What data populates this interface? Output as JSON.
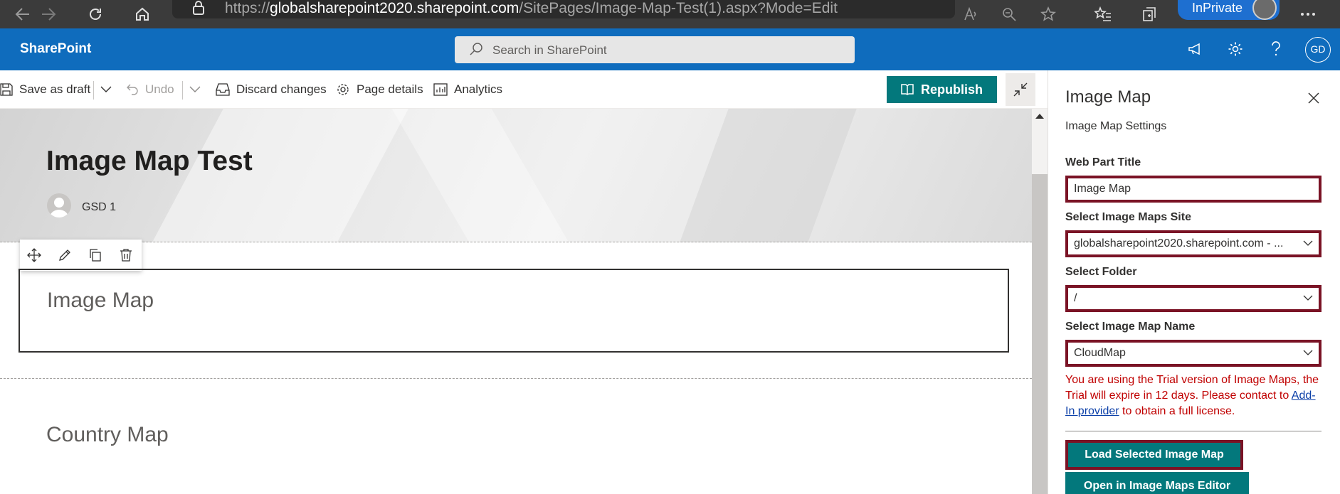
{
  "browser": {
    "url_prefix": "https://",
    "url_domain": "globalsharepoint2020.sharepoint.com",
    "url_path": "/SitePages/Image-Map-Test(1).aspx?Mode=Edit",
    "inprivate_label": "InPrivate",
    "icons": [
      "back-icon",
      "forward-icon",
      "refresh-icon",
      "home-icon",
      "lock-icon",
      "read-aloud-icon",
      "zoom-icon",
      "add-favorite-icon",
      "favorites-icon",
      "collections-icon",
      "more-icon"
    ]
  },
  "suite": {
    "brand": "SharePoint",
    "search_placeholder": "Search in SharePoint",
    "user_initials": "GD",
    "color": "#0f6cbd"
  },
  "commands": {
    "save_draft": "Save as draft",
    "undo": "Undo",
    "discard": "Discard changes",
    "page_details": "Page details",
    "analytics": "Analytics",
    "republish": "Republish"
  },
  "page": {
    "title": "Image Map Test",
    "author": "GSD 1",
    "webpart_title": "Image Map",
    "section_title": "Country Map"
  },
  "pane": {
    "title": "Image Map",
    "subtitle": "Image Map Settings",
    "webpart_title_label": "Web Part Title",
    "webpart_title_value": "Image Map",
    "site_label": "Select Image Maps Site",
    "site_value": "globalsharepoint2020.sharepoint.com - ...",
    "folder_label": "Select Folder",
    "folder_value": "/",
    "name_label": "Select Image Map Name",
    "name_value": "CloudMap",
    "trial_text_1": "You are using the Trial version of Image Maps, the Trial will expire in 12 days. Please contact to",
    "trial_link": "Add-In provider",
    "trial_text_2": "to obtain a full license.",
    "load_button": "Load Selected Image Map",
    "editor_button": "Open in Image Maps Editor",
    "accent": "#03787c",
    "highlight": "#7a1325"
  }
}
